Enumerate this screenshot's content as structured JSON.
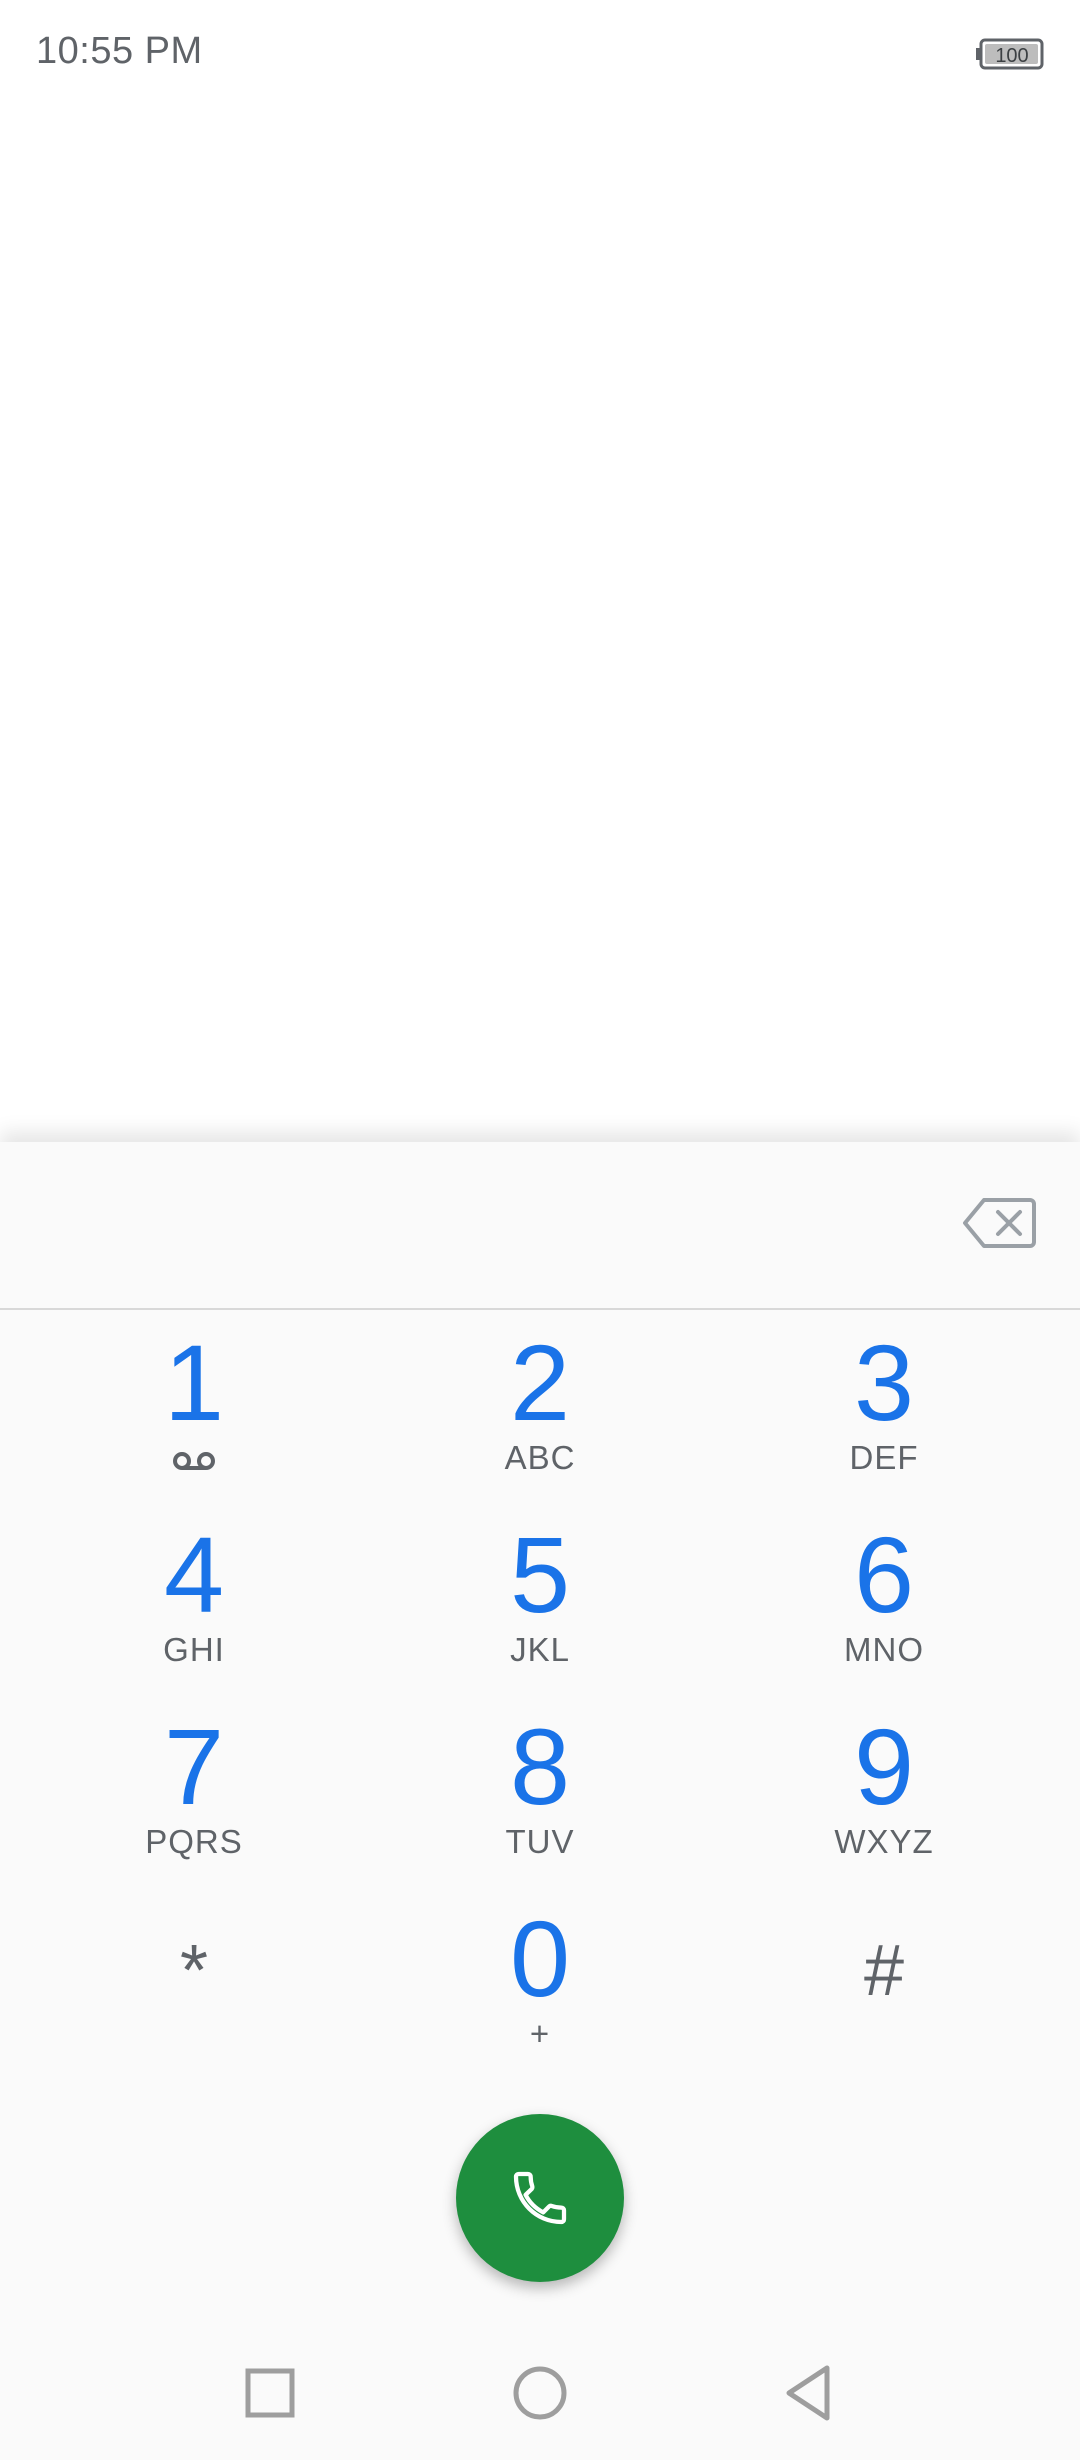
{
  "status_bar": {
    "time": "10:55 PM",
    "battery_level": "100"
  },
  "dialpad": {
    "digits": "",
    "keys": [
      {
        "digit": "1",
        "letters": "",
        "icon": "voicemail-icon"
      },
      {
        "digit": "2",
        "letters": "ABC"
      },
      {
        "digit": "3",
        "letters": "DEF"
      },
      {
        "digit": "4",
        "letters": "GHI"
      },
      {
        "digit": "5",
        "letters": "JKL"
      },
      {
        "digit": "6",
        "letters": "MNO"
      },
      {
        "digit": "7",
        "letters": "PQRS"
      },
      {
        "digit": "8",
        "letters": "TUV"
      },
      {
        "digit": "9",
        "letters": "WXYZ"
      },
      {
        "symbol": "*",
        "letters": ""
      },
      {
        "digit": "0",
        "letters": "+"
      },
      {
        "symbol": "#",
        "letters": ""
      }
    ]
  },
  "icons": {
    "backspace": "backspace-icon",
    "call": "phone-icon",
    "nav_recent": "square-icon",
    "nav_home": "circle-icon",
    "nav_back": "triangle-back-icon"
  },
  "colors": {
    "digit_blue": "#1a73e8",
    "call_green": "#1e8e3e",
    "secondary_text": "#5f6368"
  }
}
